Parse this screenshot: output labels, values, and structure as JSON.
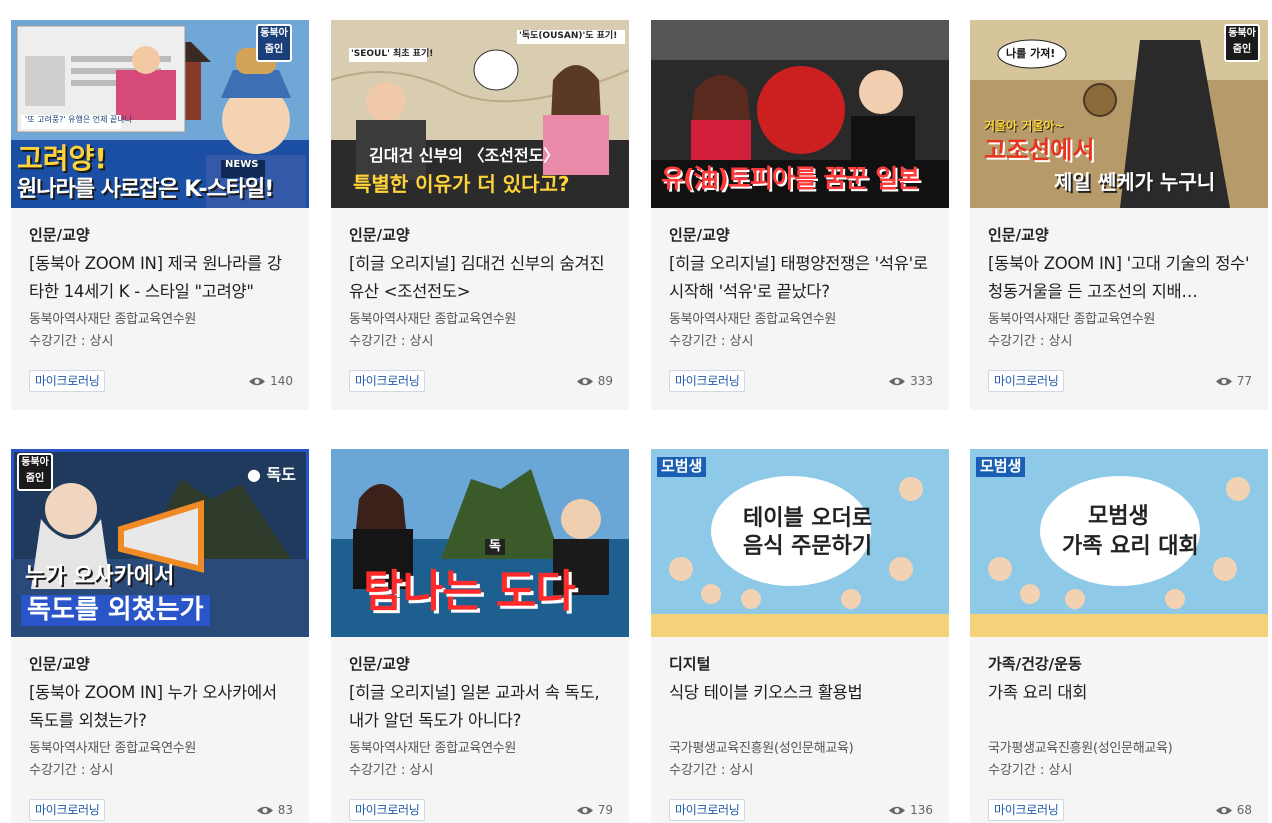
{
  "courses": [
    {
      "thumb": {
        "main_line1": "고려양!",
        "main_line2": "원나라를 사로잡은 K-스타일!",
        "caption": "'또 고려풍?' 유행은 언제 끝나나",
        "news": "NEWS",
        "brand": "동북아 줌인",
        "bg": "#1a4fa3"
      },
      "category": "인문/교양",
      "title": "[동북아 ZOOM IN] 제국 원나라를 강타한 14세기 K - 스타일 \"고려양\"",
      "org": "동북아역사재단 종합교육연수원",
      "period": "수강기간 : 상시",
      "badge": "마이크로러닝",
      "views": "140"
    },
    {
      "thumb": {
        "main_line1": "김대건 신부의 〈조선전도〉",
        "main_line2": "특별한 이유가 더 있다고?",
        "label_a": "'SEOUL' 최초 표기!",
        "label_b": "'독도(OUSAN)'도 표기!",
        "bg": "#d8cdb0"
      },
      "category": "인문/교양",
      "title": "[히글 오리지널] 김대건 신부의 숨겨진 유산 <조선전도>",
      "org": "동북아역사재단 종합교육연수원",
      "period": "수강기간 : 상시",
      "badge": "마이크로러닝",
      "views": "89"
    },
    {
      "thumb": {
        "main_line1": "유(油)토피아를 꿈꾼 일본",
        "bg": "#2a2a2a"
      },
      "category": "인문/교양",
      "title": "[히글 오리지널] 태평양전쟁은 '석유'로 시작해 '석유'로 끝났다?",
      "org": "동북아역사재단 종합교육연수원",
      "period": "수강기간 : 상시",
      "badge": "마이크로러닝",
      "views": "333"
    },
    {
      "thumb": {
        "bubble": "나를 가져!",
        "line1": "거울아 거울아~",
        "line2": "고조선에서",
        "line3": "제일 쎈케가 누구니",
        "brand": "동북아 줌인",
        "bg": "#b79a6a"
      },
      "category": "인문/교양",
      "title": "[동북아 ZOOM IN] '고대 기술의 정수' 청동거울을 든 고조선의 지배…",
      "org": "동북아역사재단 종합교육연수원",
      "period": "수강기간 : 상시",
      "badge": "마이크로러닝",
      "views": "77"
    },
    {
      "thumb": {
        "line1": "누가 오사카에서",
        "line2": "독도를 외쳤는가",
        "place": "독도",
        "brand": "동북아 줌인",
        "bg": "#1f3a5c"
      },
      "category": "인문/교양",
      "title": "[동북아 ZOOM IN] 누가 오사카에서 독도를 외쳤는가?",
      "org": "동북아역사재단 종합교육연수원",
      "period": "수강기간 : 상시",
      "badge": "마이크로러닝",
      "views": "83"
    },
    {
      "thumb": {
        "main_line1": "탐나는 도다",
        "tag": "독",
        "bg": "#1d5f8f"
      },
      "category": "인문/교양",
      "title": "[히글 오리지널] 일본 교과서 속 독도, 내가 알던 독도가 아니다?",
      "org": "동북아역사재단 종합교육연수원",
      "period": "수강기간 : 상시",
      "badge": "마이크로러닝",
      "views": "79"
    },
    {
      "thumb": {
        "logo": "모범생",
        "line1": "테이블 오더로",
        "line2": "음식 주문하기",
        "bg": "#8ec9e8"
      },
      "category": "디지털",
      "title": "식당 테이블 키오스크 활용법",
      "org": "국가평생교육진흥원(성인문해교육)",
      "period": "수강기간 : 상시",
      "badge": "마이크로러닝",
      "views": "136"
    },
    {
      "thumb": {
        "logo": "모범생",
        "line1": "모범생",
        "line2": "가족 요리 대회",
        "bg": "#8ec9e8"
      },
      "category": "가족/건강/운동",
      "title": "가족 요리 대회",
      "org": "국가평생교육진흥원(성인문해교육)",
      "period": "수강기간 : 상시",
      "badge": "마이크로러닝",
      "views": "68"
    }
  ]
}
